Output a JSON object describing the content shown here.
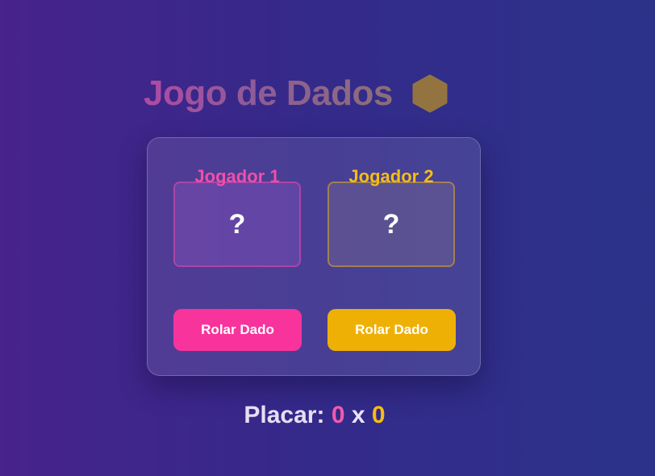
{
  "header": {
    "title": "Jogo de Dados",
    "icon": "hexagon-dice-icon",
    "icon_color": "#937440"
  },
  "players": [
    {
      "name": "Jogador 1",
      "die_value": "?",
      "button_label": "Rolar Dado",
      "color": "#f8349c"
    },
    {
      "name": "Jogador 2",
      "die_value": "?",
      "button_label": "Rolar Dado",
      "color": "#efb005"
    }
  ],
  "score": {
    "label": "Placar:",
    "player1": "0",
    "separator": "x",
    "player2": "0"
  }
}
